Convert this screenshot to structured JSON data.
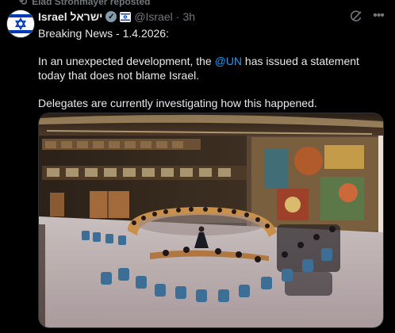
{
  "repost": {
    "text": "Elad Stronmayer reposted"
  },
  "author": {
    "name": "Israel ישראל",
    "handle": "@Israel",
    "separator": "·",
    "time": "3h"
  },
  "tweet": {
    "line1": "Breaking News - 1.4.2026:",
    "line2_before": "In an unexpected development, the ",
    "line2_mention": "@UN",
    "line2_after": " has issued a statement today that does not blame Israel.",
    "line3": "Delegates are currently investigating how this happened."
  },
  "icons": {
    "repost": "repost-icon",
    "verified": "verified-badge-icon",
    "affiliate": "government-flag-icon",
    "grok": "grok-icon",
    "more": "more-options-icon"
  },
  "colors": {
    "background": "#000000",
    "text": "#e7e9ea",
    "muted": "#71767b",
    "link": "#1d9bf0",
    "badge": "#829aab"
  },
  "media": {
    "type": "photo",
    "subject": "security-council-chamber"
  }
}
